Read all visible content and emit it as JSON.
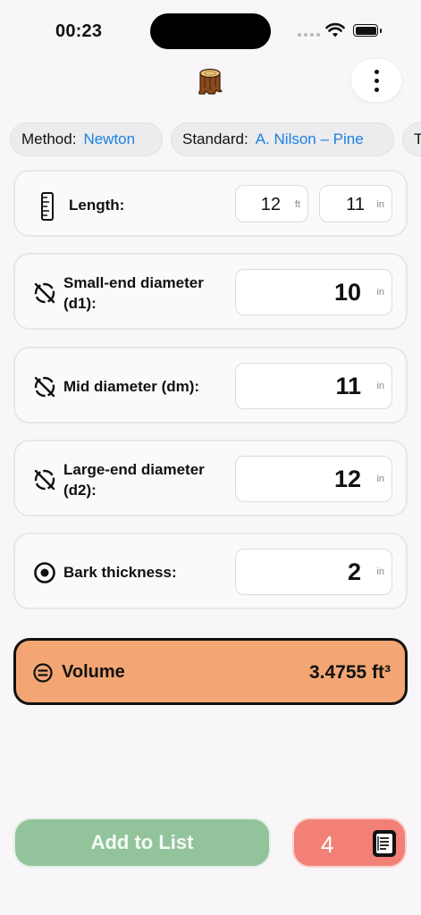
{
  "status_bar": {
    "time": "00:23"
  },
  "header": {
    "logo_icon": "log-stump-icon",
    "more_icon": "vertical-ellipsis-icon"
  },
  "chips": [
    {
      "label": "Method:",
      "value": "Newton"
    },
    {
      "label": "Standard:",
      "value": "A. Nilson – Pine"
    },
    {
      "label": "T",
      "value": ""
    }
  ],
  "length": {
    "label": "Length:",
    "feet": "12",
    "feet_unit": "ft",
    "inches": "11",
    "inches_unit": "in",
    "icon": "ruler-icon"
  },
  "small_end": {
    "label_line1": "Small-end diameter",
    "label_line2": "(d1):",
    "value": "10",
    "unit": "in",
    "icon": "diameter-icon"
  },
  "mid": {
    "label": "Mid diameter (dm):",
    "value": "11",
    "unit": "in",
    "icon": "diameter-icon"
  },
  "large_end": {
    "label_line1": "Large-end diameter",
    "label_line2": "(d2):",
    "value": "12",
    "unit": "in",
    "icon": "diameter-icon"
  },
  "bark": {
    "label": "Bark thickness:",
    "value": "2",
    "unit": "in",
    "icon": "bark-ring-icon"
  },
  "volume": {
    "label": "Volume",
    "value": "3.4755 ft³",
    "icon": "equals-circle-icon"
  },
  "actions": {
    "add_label": "Add to List",
    "list_count": "4",
    "list_icon": "notebook-icon"
  },
  "colors": {
    "accent_blue": "#1a82e4",
    "volume_bg": "#f3a673",
    "add_button": "#93c39b",
    "list_button": "#f28076"
  }
}
